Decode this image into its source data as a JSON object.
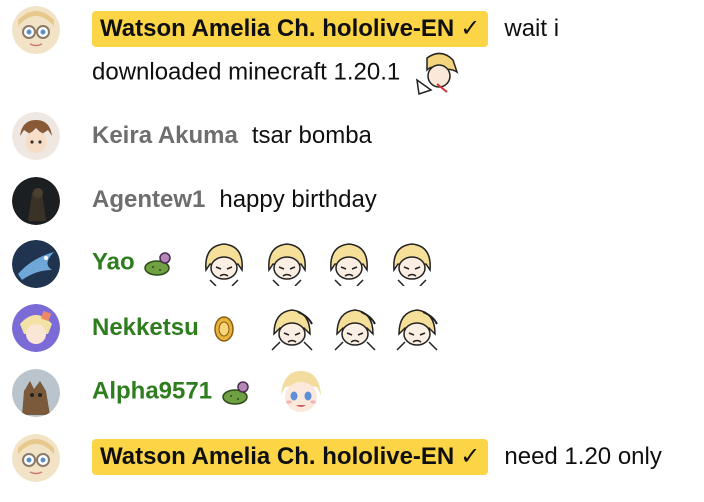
{
  "messages": [
    {
      "author": "Watson Amelia Ch. hololive-EN",
      "verified_icon": "checkmark-icon",
      "text_line1": "wait i",
      "text_line2": "downloaded minecraft 1.20.1",
      "emotes": [
        "amelia-emote"
      ]
    },
    {
      "author": "Keira Akuma",
      "text": "tsar bomba"
    },
    {
      "author": "Agentew1",
      "text": "happy birthday"
    },
    {
      "author": "Yao",
      "badge": "cactus-member-badge",
      "emotes": [
        "amelia-emote",
        "amelia-emote",
        "amelia-emote",
        "amelia-emote"
      ]
    },
    {
      "author": "Nekketsu",
      "badge": "gold-member-badge",
      "emotes": [
        "amelia-salute-emote",
        "amelia-salute-emote",
        "amelia-salute-emote"
      ]
    },
    {
      "author": "Alpha9571",
      "badge": "cactus-member-badge",
      "emotes": [
        "amelia-face-emote"
      ]
    },
    {
      "author": "Watson Amelia Ch. hololive-EN",
      "verified_icon": "checkmark-icon",
      "text": "need 1.20 only"
    }
  ],
  "colors": {
    "owner_badge_bg": "#fcd547",
    "member_name": "#2e7d1e",
    "regular_name": "#6e6e6e"
  }
}
